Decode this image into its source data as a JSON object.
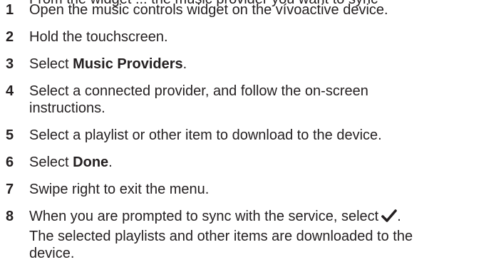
{
  "cropped_intro": "From the widget ... the music provider you want to sync",
  "steps": [
    {
      "number": "1",
      "text": "Open the music controls widget on the vívoactive device."
    },
    {
      "number": "2",
      "text": "Hold the touchscreen."
    },
    {
      "number": "3",
      "prefix": "Select ",
      "bold": "Music Providers",
      "suffix": "."
    },
    {
      "number": "4",
      "text_line1": "Select a connected provider, and follow the on-screen",
      "text_line2": "instructions."
    },
    {
      "number": "5",
      "text": "Select a playlist or other item to download to the device."
    },
    {
      "number": "6",
      "prefix": "Select ",
      "bold": "Done",
      "suffix": "."
    },
    {
      "number": "7",
      "text": "Swipe right to exit the menu."
    },
    {
      "number": "8",
      "text": "When you are prompted to sync with the service, select",
      "icon": "checkmark-icon",
      "suffix": "."
    }
  ],
  "result_note_line1": "The selected playlists and other items are downloaded to the",
  "result_note_line2": "device."
}
